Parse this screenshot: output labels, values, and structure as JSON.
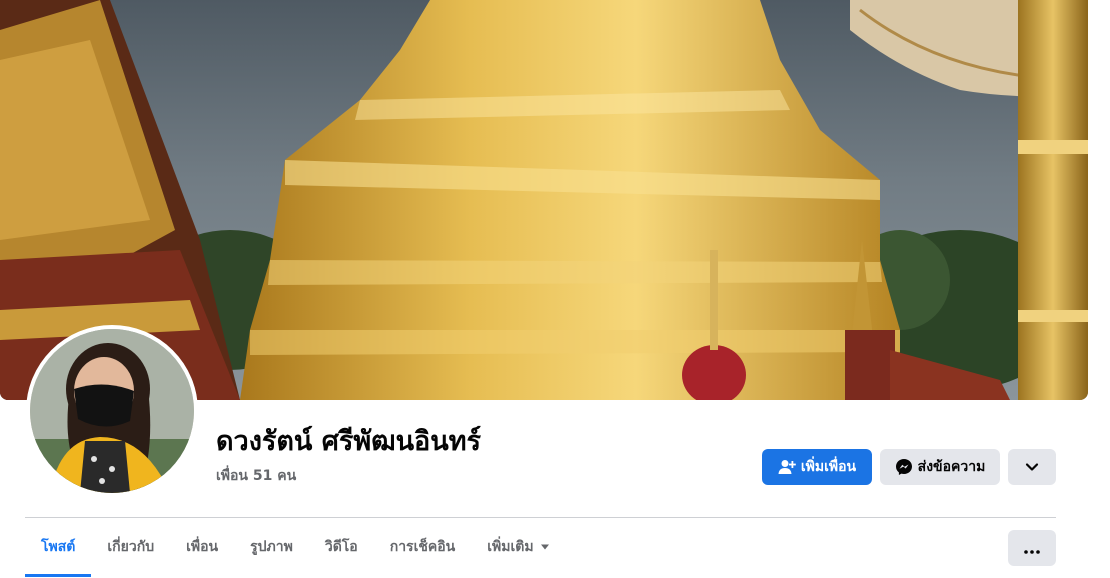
{
  "profile": {
    "name": "ดวงรัตน์ ศรีพัฒนอินทร์",
    "friends": "เพื่อน 51 คน"
  },
  "actions": {
    "add_friend": "เพิ่มเพื่อน",
    "message": "ส่งข้อความ"
  },
  "tabs": [
    {
      "label": "โพสต์",
      "active": true
    },
    {
      "label": "เกี่ยวกับ"
    },
    {
      "label": "เพื่อน"
    },
    {
      "label": "รูปภาพ"
    },
    {
      "label": "วิดีโอ"
    },
    {
      "label": "การเช็คอิน"
    },
    {
      "label": "เพิ่มเติม"
    }
  ],
  "icons": {
    "add_friend": "person-plus-icon",
    "message": "messenger-icon",
    "expand": "chevron-down-icon",
    "more_tab": "caret-down-icon",
    "more_options": "ellipsis-icon"
  },
  "colors": {
    "primary": "#1b74e4",
    "active_tab": "#1877f2",
    "secondary_button": "#e4e6eb",
    "muted_text": "#65676b"
  }
}
